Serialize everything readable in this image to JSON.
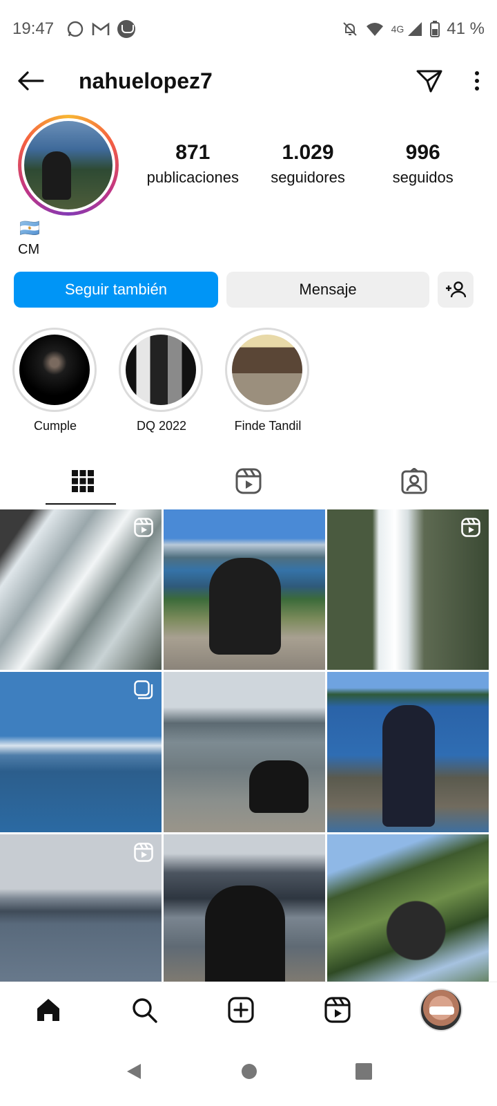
{
  "status": {
    "time": "19:47",
    "network": "4G",
    "battery": "41 %"
  },
  "topbar": {
    "username": "nahuelopez7"
  },
  "profile": {
    "stats": [
      {
        "num": "871",
        "label": "publicaciones"
      },
      {
        "num": "1.029",
        "label": "seguidores"
      },
      {
        "num": "996",
        "label": "seguidos"
      }
    ],
    "flag": "🇦🇷",
    "bio_name": "CM"
  },
  "buttons": {
    "follow": "Seguir también",
    "message": "Mensaje"
  },
  "highlights": [
    {
      "label": "Cumple"
    },
    {
      "label": "DQ 2022"
    },
    {
      "label": "Finde Tandil"
    }
  ],
  "tabs": [
    "grid-icon",
    "reels-icon",
    "tagged-icon"
  ],
  "grid": [
    {
      "badge": "reel"
    },
    {
      "badge": ""
    },
    {
      "badge": "reel"
    },
    {
      "badge": "carousel"
    },
    {
      "badge": ""
    },
    {
      "badge": ""
    },
    {
      "badge": "reel"
    },
    {
      "badge": ""
    },
    {
      "badge": ""
    }
  ],
  "colors": {
    "accent": "#0095f6",
    "button_bg": "#efefef",
    "text": "#111111"
  }
}
